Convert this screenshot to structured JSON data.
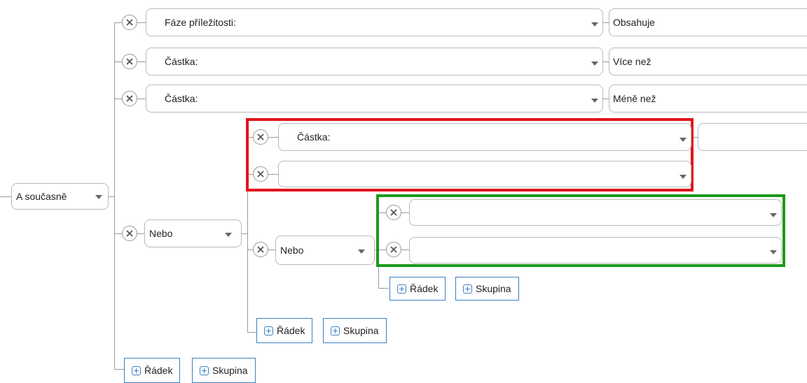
{
  "root": {
    "operator": "A současně"
  },
  "rows": [
    {
      "field": "Fáze příležitosti:",
      "condition": "Obsahuje"
    },
    {
      "field": "Částka:",
      "condition": "Více než"
    },
    {
      "field": "Částka:",
      "condition": "Méně než"
    }
  ],
  "group1": {
    "operator": "Nebo",
    "rows": [
      {
        "field": "Částka:",
        "condition": ""
      },
      {
        "field": "",
        "condition": ""
      }
    ],
    "group2": {
      "operator": "Nebo",
      "rows": [
        {
          "field": ""
        },
        {
          "field": ""
        }
      ],
      "add_row": "Řádek",
      "add_group": "Skupina"
    },
    "add_row": "Řádek",
    "add_group": "Skupina"
  },
  "root_add_row": "Řádek",
  "root_add_group": "Skupina",
  "colors": {
    "highlight_red": "#e4141b",
    "highlight_green": "#1c9a1c",
    "button_border": "#3c7fc4"
  },
  "icons": {
    "remove": "x-circle-icon",
    "dropdown": "chevron-down-icon",
    "add": "plus-square-icon"
  }
}
